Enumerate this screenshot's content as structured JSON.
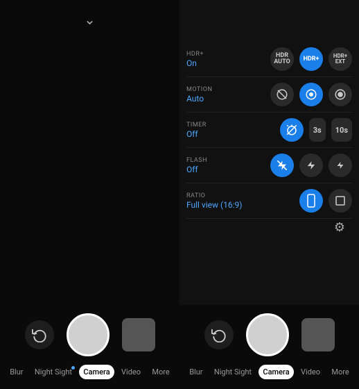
{
  "left_panel": {
    "chevron": "⌄",
    "controls": {
      "rotate_icon": "↺",
      "shutter": "",
      "gallery": ""
    },
    "tabs": [
      {
        "id": "blur",
        "label": "Blur",
        "active": false,
        "dot": false
      },
      {
        "id": "night",
        "label": "Night Sight",
        "active": false,
        "dot": true
      },
      {
        "id": "camera",
        "label": "Camera",
        "active": true,
        "dot": false
      },
      {
        "id": "video",
        "label": "Video",
        "active": false,
        "dot": false
      },
      {
        "id": "more",
        "label": "More",
        "active": false,
        "dot": false
      }
    ]
  },
  "right_panel": {
    "settings": [
      {
        "key": "HDR+",
        "value": "On",
        "icons": [
          "hdr-auto",
          "hdr-plus-active",
          "hdr-plus-ext"
        ]
      },
      {
        "key": "MOTION",
        "value": "Auto",
        "icons": [
          "motion-off",
          "motion-auto-active",
          "motion-on"
        ]
      },
      {
        "key": "TIMER",
        "value": "Off",
        "icons": [
          "timer-off-active",
          "timer-3s",
          "timer-10s"
        ]
      },
      {
        "key": "FLASH",
        "value": "Off",
        "icons": [
          "flash-off-active",
          "flash-auto",
          "flash-on"
        ]
      },
      {
        "key": "RATIO",
        "value": "Full view (16:9)",
        "icons": [
          "ratio-full-active",
          "ratio-square"
        ]
      }
    ],
    "controls": {
      "rotate_icon": "↺",
      "shutter": "",
      "gallery": ""
    },
    "tabs": [
      {
        "id": "blur",
        "label": "Blur",
        "active": false,
        "dot": false
      },
      {
        "id": "night",
        "label": "Night Sight",
        "active": false,
        "dot": false
      },
      {
        "id": "camera",
        "label": "Camera",
        "active": true,
        "dot": false
      },
      {
        "id": "video",
        "label": "Video",
        "active": false,
        "dot": false
      },
      {
        "id": "more",
        "label": "More",
        "active": false,
        "dot": false
      }
    ]
  }
}
